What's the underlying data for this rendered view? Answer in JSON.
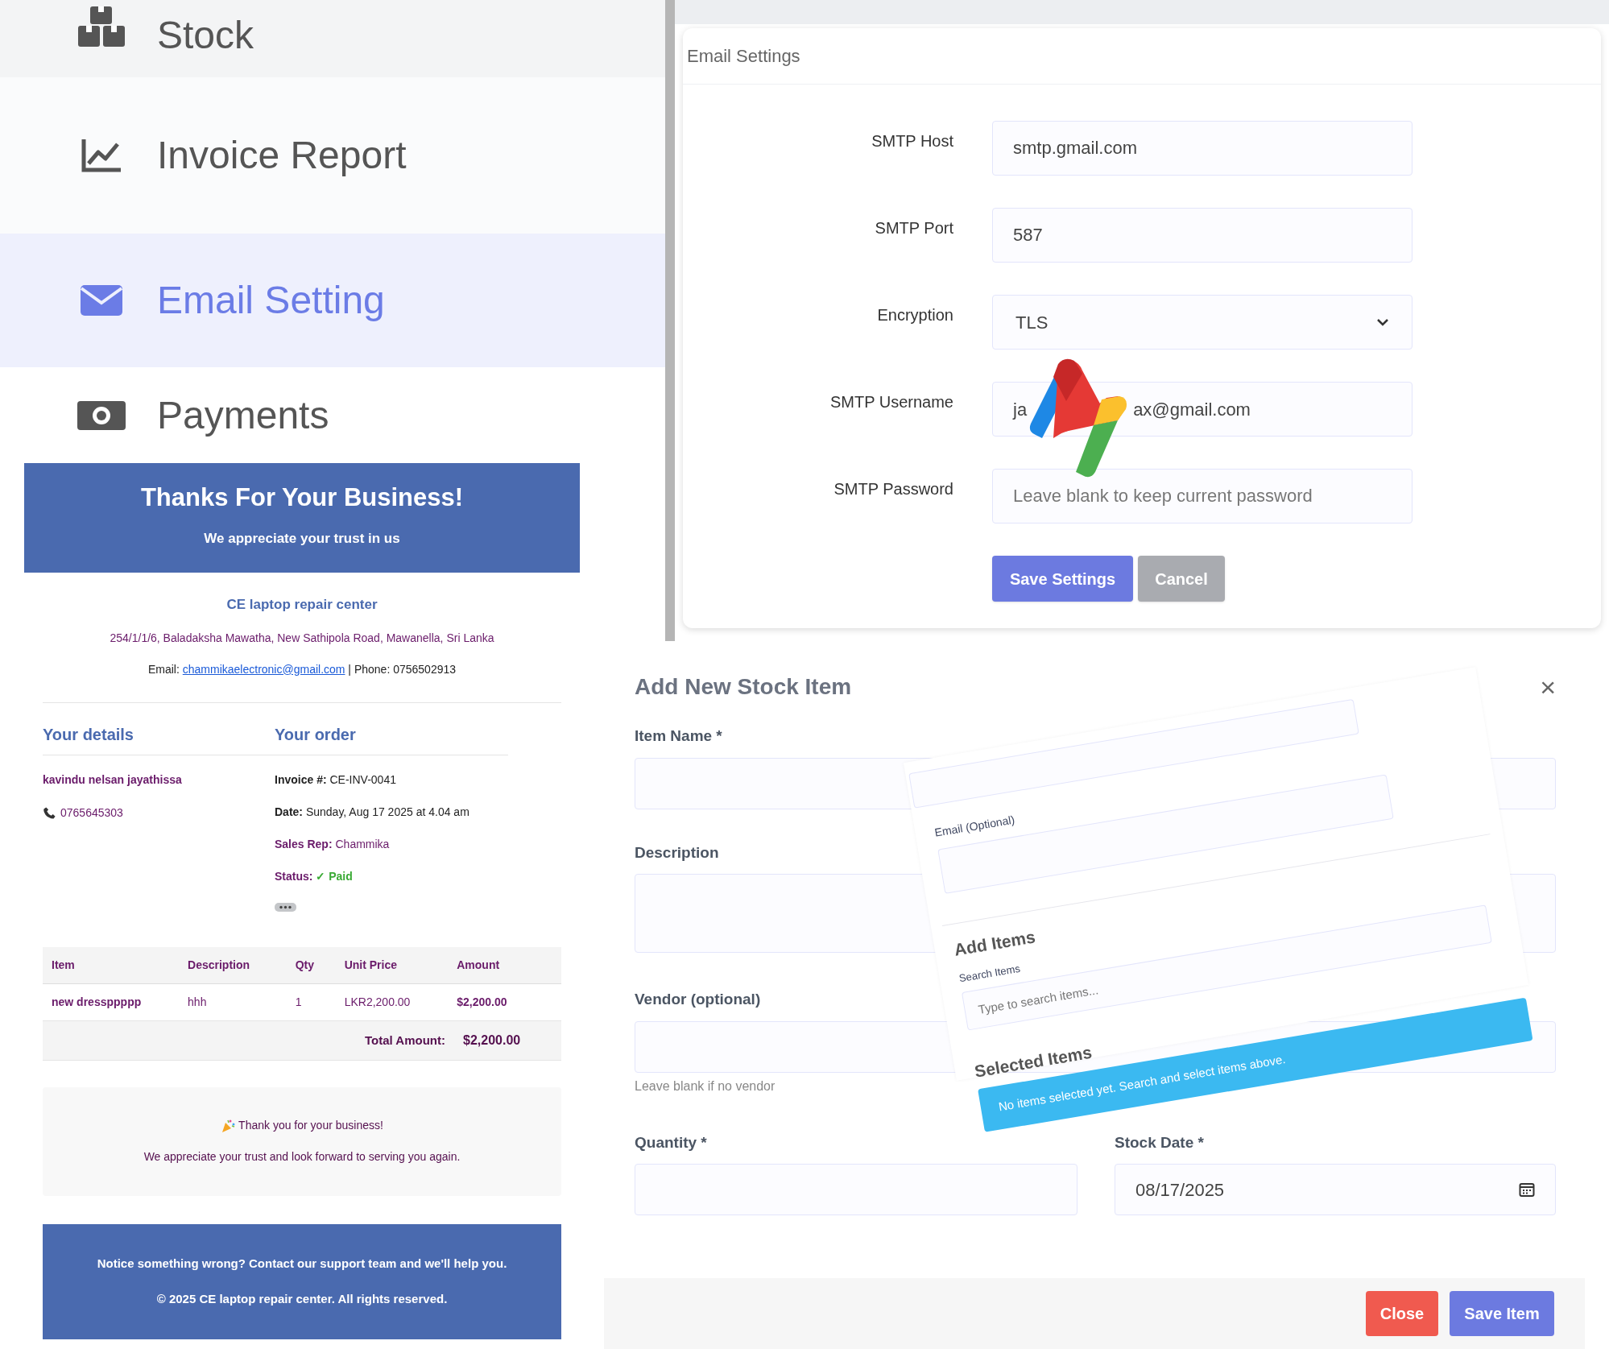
{
  "sidebar": {
    "items": [
      {
        "label": "Stock",
        "kind": "boxes",
        "selected": false
      },
      {
        "label": "Invoice Report",
        "kind": "chart",
        "selected": false
      },
      {
        "label": "Email Setting",
        "kind": "envelope",
        "selected": true
      },
      {
        "label": "Payments",
        "kind": "money",
        "selected": false
      }
    ]
  },
  "email_settings": {
    "title": "Email Settings",
    "fields": [
      {
        "label": "SMTP Host",
        "kind": "text",
        "value": "smtp.gmail.com"
      },
      {
        "label": "SMTP Port",
        "kind": "text",
        "value": "587"
      },
      {
        "label": "Encryption",
        "kind": "select",
        "value": "TLS"
      },
      {
        "label": "SMTP Username",
        "kind": "covered",
        "value_start": "ja",
        "value_end": "ax@gmail.com"
      },
      {
        "label": "SMTP Password",
        "kind": "password",
        "placeholder": "Leave blank to keep current password"
      }
    ],
    "buttons": [
      {
        "label": "Save Settings",
        "kind": "primary"
      },
      {
        "label": "Cancel",
        "kind": "secondary"
      }
    ]
  },
  "invoice": {
    "banner_title": "Thanks For Your Business!",
    "banner_subtitle": "We appreciate your trust in us",
    "company": "CE laptop repair center",
    "address": "254/1/1/6, Baladaksha Mawatha, New Sathipola Road, Mawanella, Sri Lanka",
    "email_label": "Email:",
    "email": "chammikaelectronic@gmail.com",
    "phone_text": "| Phone: 0756502913",
    "details_heading": "Your details",
    "order_heading": "Your order",
    "customer_name": "kavindu nelsan jayathissa",
    "customer_phone": "0765645303",
    "order_lines": [
      {
        "label": "Invoice #:",
        "value": "CE-INV-0041",
        "kind": "plain"
      },
      {
        "label": "Date:",
        "value": "Sunday, Aug 17 2025 at 4.04 am",
        "kind": "plain"
      },
      {
        "label": "Sales Rep:",
        "value": "Chammika",
        "kind": "purple"
      },
      {
        "label": "Status:",
        "value": "✓ Paid",
        "kind": "status"
      }
    ],
    "table": {
      "columns": [
        "Item",
        "Description",
        "Qty",
        "Unit Price",
        "Amount"
      ],
      "rows": [
        [
          "new dressppppp",
          "hhh",
          "1",
          "LKR2,200.00",
          "$2,200.00"
        ]
      ],
      "total_label": "Total Amount:",
      "total_value": "$2,200.00"
    },
    "thanks_line": "Thank you for your business!",
    "thanks_sub": "We appreciate your trust and look forward to serving you again.",
    "footer_lines": [
      "Notice something wrong? Contact our support team and we'll help you.",
      "© 2025 CE laptop repair center. All rights reserved."
    ]
  },
  "stock_modal": {
    "title": "Add New Stock Item",
    "close": "×",
    "item_name_label": "Item Name *",
    "description_label": "Description",
    "vendor_label": "Vendor (optional)",
    "vendor_hint": "Leave blank if no vendor",
    "quantity_label": "Quantity *",
    "date_label": "Stock Date *",
    "date_value": "08/17/2025",
    "buttons": [
      {
        "label": "Close",
        "kind": "danger"
      },
      {
        "label": "Save Item",
        "kind": "primary"
      }
    ]
  },
  "overlay_panel": {
    "email_label": "Email (Optional)",
    "add_heading": "Add Items",
    "search_label": "Search Items",
    "search_placeholder": "Type to search items...",
    "selected_heading": "Selected Items",
    "empty_message": "No items selected yet. Search and select items above."
  }
}
